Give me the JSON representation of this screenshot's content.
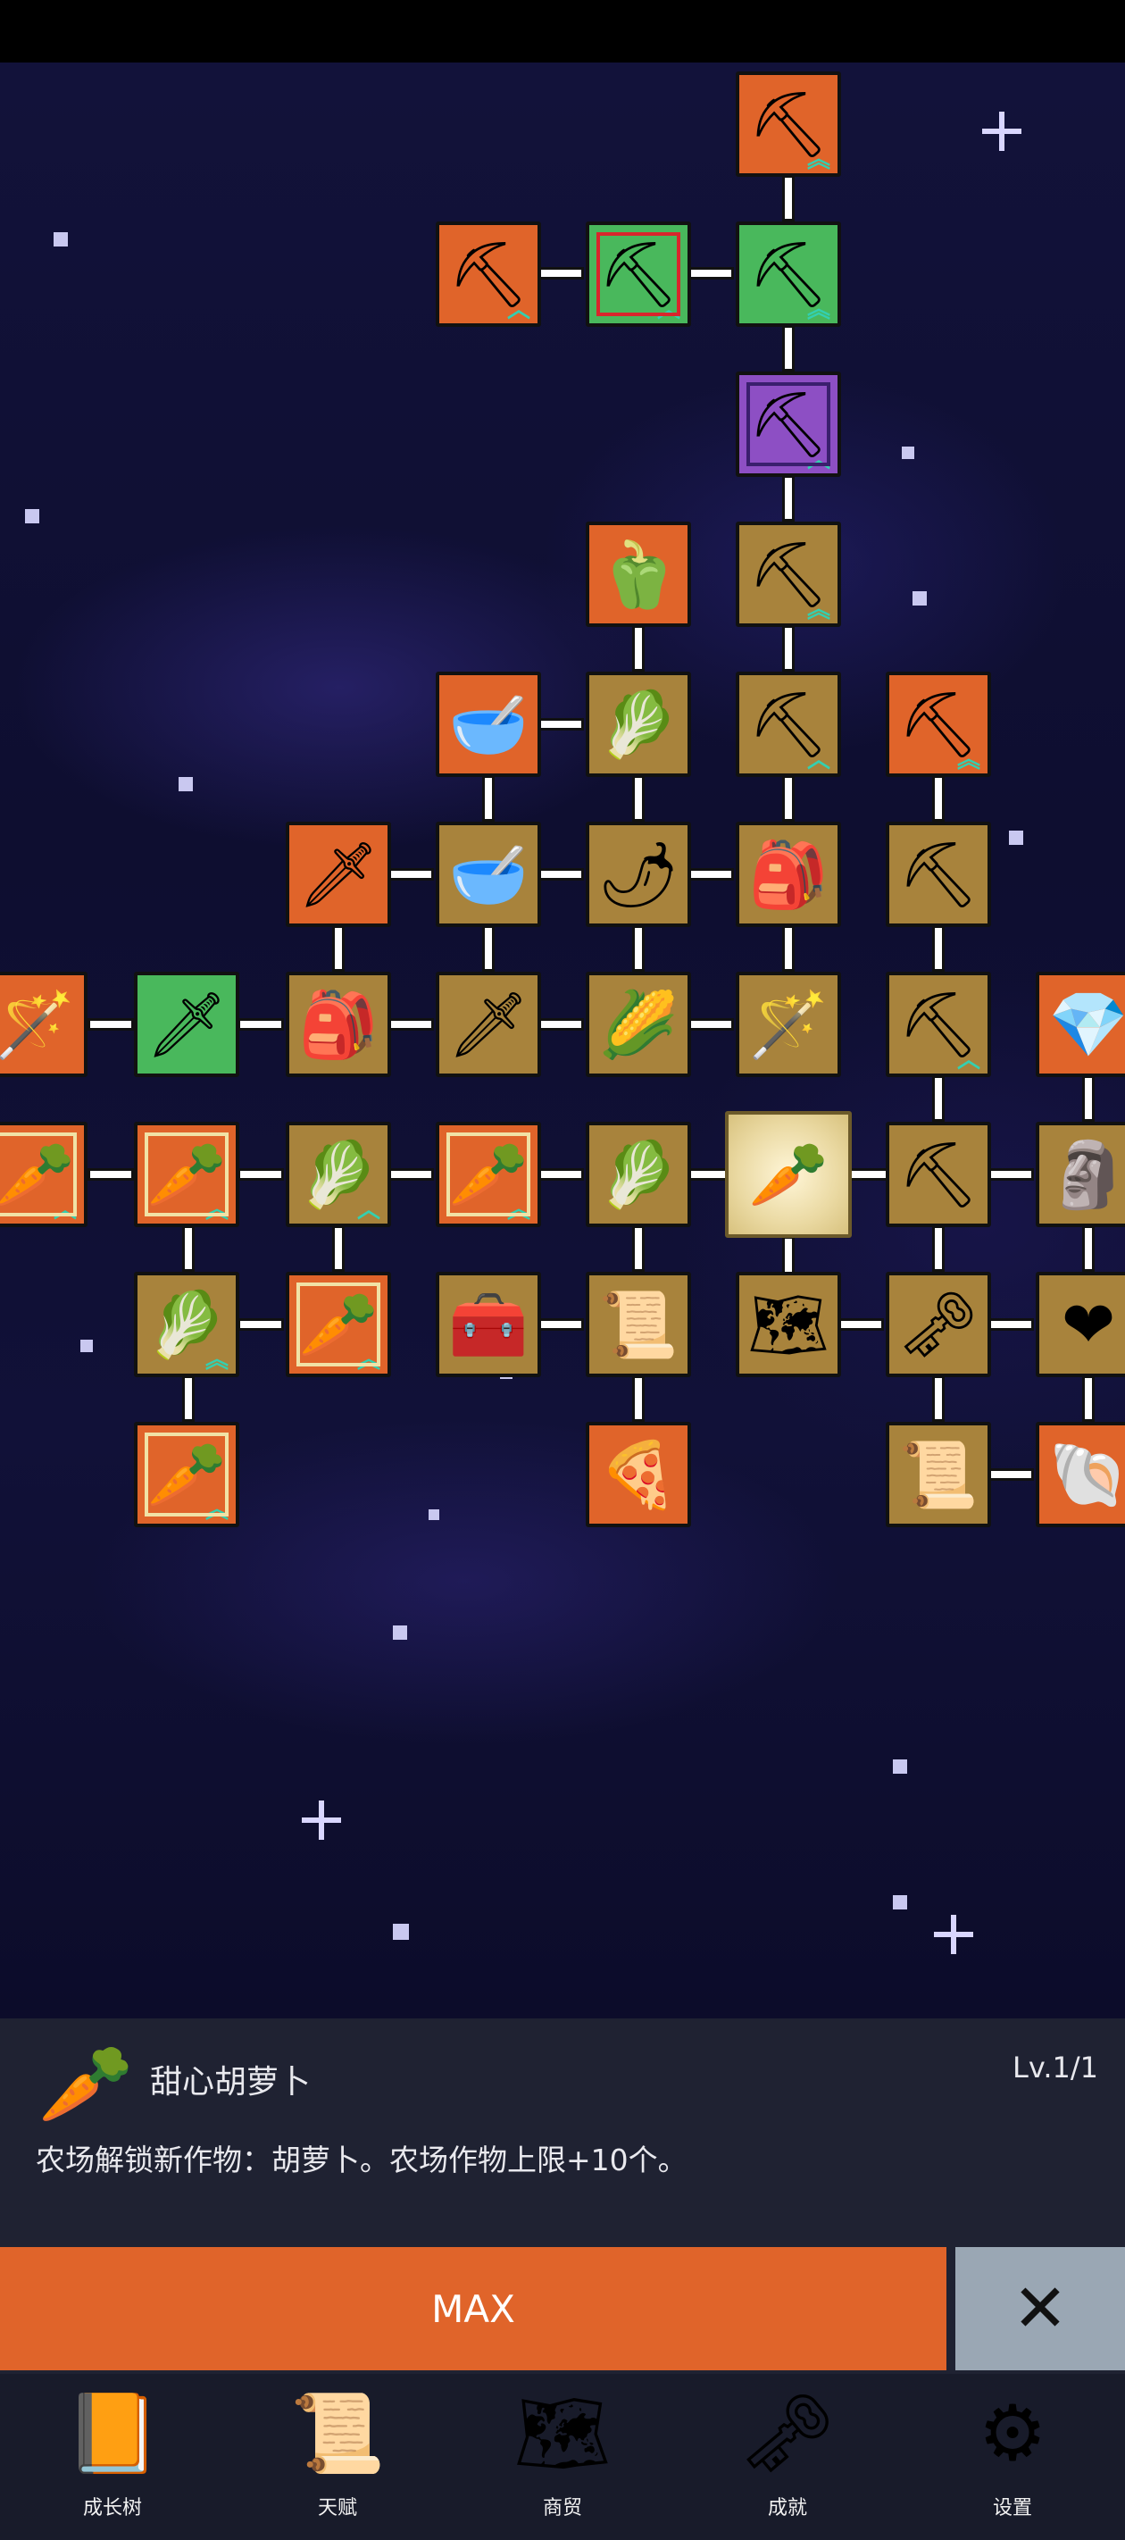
{
  "tree": {
    "nodes": [
      {
        "id": "shovel-top",
        "icon": "🪚",
        "color": "orange",
        "up": "»"
      },
      {
        "id": "shovel-left",
        "icon": "🪚",
        "color": "orange",
        "up": "»"
      },
      {
        "id": "shovel-red",
        "icon": "🪚",
        "color": "green",
        "up": "»"
      },
      {
        "id": "shovel-green",
        "icon": "🪚",
        "color": "green",
        "up": "»"
      },
      {
        "id": "shovel-purple",
        "icon": "🪚",
        "color": "purple",
        "up": "»"
      }
    ]
  },
  "selected_item": {
    "icon": "🥕",
    "title": "甜心胡萝卜",
    "level": "Lv.1/1",
    "description": "农场解锁新作物：胡萝卜。农场作物上限+10个。"
  },
  "actions": {
    "max_label": "MAX",
    "close_icon": "✕"
  },
  "nav": [
    {
      "label": "成长树",
      "icon": "📙"
    },
    {
      "label": "天赋",
      "icon": "📜"
    },
    {
      "label": "商贸",
      "icon": "🗺"
    },
    {
      "label": "成就",
      "icon": "🗝"
    },
    {
      "label": "设置",
      "icon": "⚙"
    }
  ],
  "colors": {
    "orange": "#e0642a",
    "brown": "#a8833c",
    "green": "#49b85c",
    "purple": "#8d4fc4",
    "panel": "#1f2232",
    "close": "#9aa7b4"
  }
}
